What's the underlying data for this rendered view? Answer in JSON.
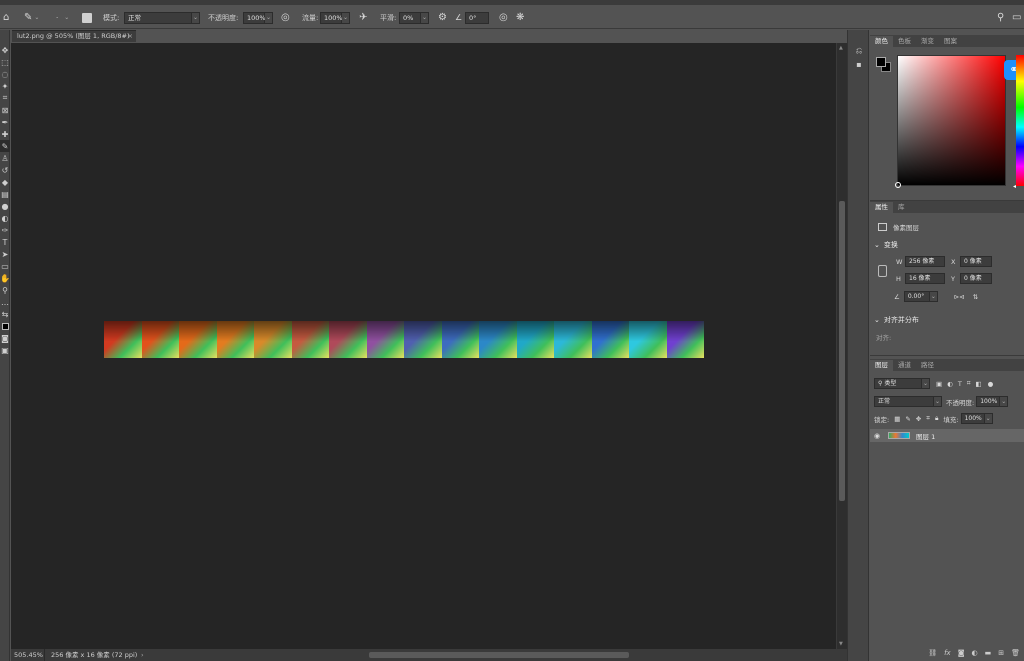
{
  "options_bar": {
    "mode_label": "模式:",
    "mode_value": "正常",
    "opacity_label": "不透明度:",
    "opacity_value": "100%",
    "flow_label": "流量:",
    "flow_value": "100%",
    "smoothing_label": "平滑:",
    "smoothing_value": "0%",
    "angle_value": "0°"
  },
  "document": {
    "tab_title": "lut2.png @ 505% (图层 1, RGB/8#)",
    "close_glyph": "×",
    "hue_hexes": [
      "#d23a20",
      "#e2521c",
      "#e46a1a",
      "#e37c20",
      "#d98a2a",
      "#c55a40",
      "#b04a5a",
      "#9050a0",
      "#5060b0",
      "#3d6cc0",
      "#2c88c8",
      "#20a8c8",
      "#2cb8d8",
      "#3070d0",
      "#2ec8e0",
      "#7040d0"
    ]
  },
  "status": {
    "zoom": "505.45%",
    "info": "256 像素 x 16 像素 (72 ppi)",
    "arrow": "›"
  },
  "color_panel": {
    "tabs": [
      "颜色",
      "色板",
      "渐变",
      "图案"
    ],
    "foreground": "#000000",
    "background": "#000000"
  },
  "properties_panel": {
    "tabs": [
      "属性",
      "库"
    ],
    "layer_type": "像素图层",
    "transform_title": "变换",
    "w_label": "W",
    "w_value": "256 像素",
    "h_label": "H",
    "h_value": "16 像素",
    "x_label": "X",
    "x_value": "0 像素",
    "y_label": "Y",
    "y_value": "0 像素",
    "angle_value": "0.00°",
    "align_title": "对齐并分布",
    "align_label": "对齐:"
  },
  "layers_panel": {
    "tabs": [
      "图层",
      "通道",
      "路径"
    ],
    "filter_label": "类型",
    "blend_mode": "正常",
    "opacity_label": "不透明度:",
    "opacity_value": "100%",
    "lock_label": "锁定:",
    "fill_label": "填充:",
    "fill_value": "100%",
    "layer_name": "图层 1"
  }
}
